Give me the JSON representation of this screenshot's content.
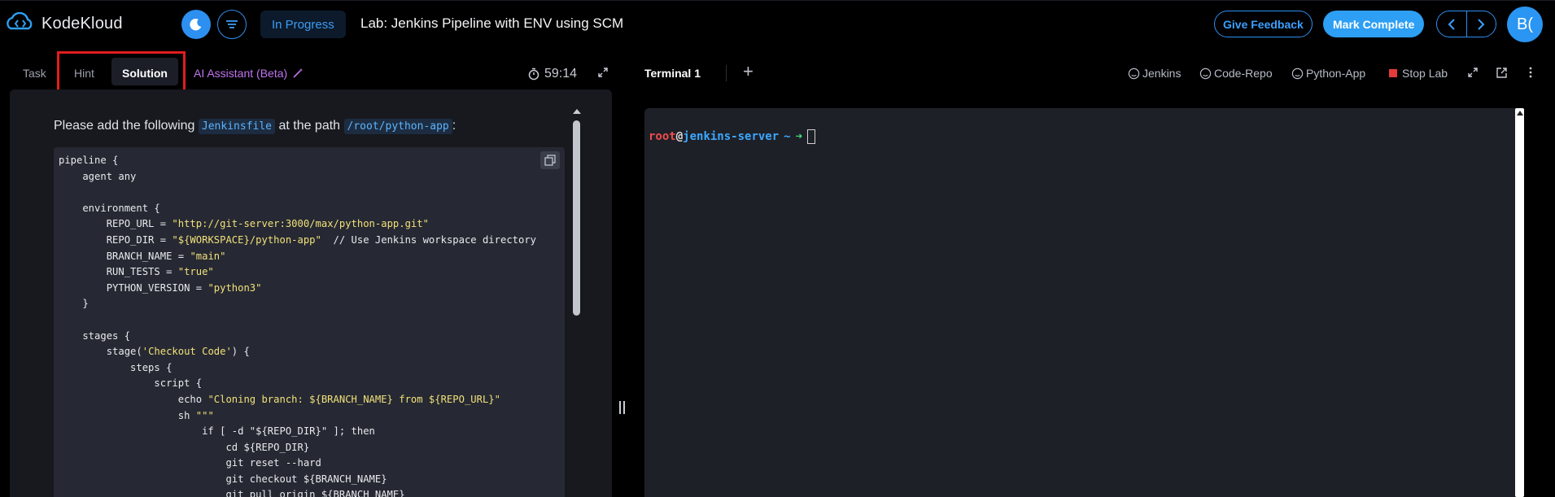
{
  "header": {
    "brand": "KodeKloud",
    "status": "In Progress",
    "lab_title": "Lab: Jenkins Pipeline with ENV using SCM",
    "feedback_label": "Give Feedback",
    "complete_label": "Mark Complete",
    "avatar_initials": "B(",
    "accent": "#2d8ff0"
  },
  "left_tabs": {
    "task": "Task",
    "hint": "Hint",
    "solution": "Solution",
    "ai_assistant": "AI Assistant (Beta)",
    "timer": "59:14",
    "active": "Solution"
  },
  "solution": {
    "instr_prefix": "Please add the following",
    "instr_file": "Jenkinsfile",
    "instr_mid": "at the path",
    "instr_path": "/root/python-app",
    "instr_suffix": ":"
  },
  "code_lines": [
    [
      "pipeline {",
      ""
    ],
    [
      "    agent any",
      ""
    ],
    [
      "",
      ""
    ],
    [
      "    environment {",
      ""
    ],
    [
      "        REPO_URL = ",
      "\"http://git-server:3000/max/python-app.git\""
    ],
    [
      "        REPO_DIR = ",
      "\"${WORKSPACE}/python-app\"",
      "  // Use Jenkins workspace directory"
    ],
    [
      "        BRANCH_NAME = ",
      "\"main\""
    ],
    [
      "        RUN_TESTS = ",
      "\"true\""
    ],
    [
      "        PYTHON_VERSION = ",
      "\"python3\""
    ],
    [
      "    }",
      ""
    ],
    [
      "",
      ""
    ],
    [
      "    stages {",
      ""
    ],
    [
      "        stage(",
      "'Checkout Code'",
      ") {"
    ],
    [
      "            steps {",
      ""
    ],
    [
      "                script {",
      ""
    ],
    [
      "                    echo ",
      "\"Cloning branch: ${BRANCH_NAME} from ${REPO_URL}\""
    ],
    [
      "                    sh ",
      "\"\"\""
    ],
    [
      "                        if [ -d \"${REPO_DIR}\" ]; then",
      ""
    ],
    [
      "                            cd ${REPO_DIR}",
      ""
    ],
    [
      "                            git reset --hard",
      ""
    ],
    [
      "                            git checkout ${BRANCH_NAME}",
      ""
    ],
    [
      "                            git pull origin ${BRANCH_NAME}",
      ""
    ]
  ],
  "terminal_tabs": {
    "active": "Terminal 1",
    "links": [
      "Jenkins",
      "Code-Repo",
      "Python-App"
    ],
    "stop": "Stop Lab"
  },
  "terminal": {
    "user": "root",
    "at": "@",
    "host": "jenkins-server",
    "tilde": "~",
    "arrow": "➜"
  }
}
